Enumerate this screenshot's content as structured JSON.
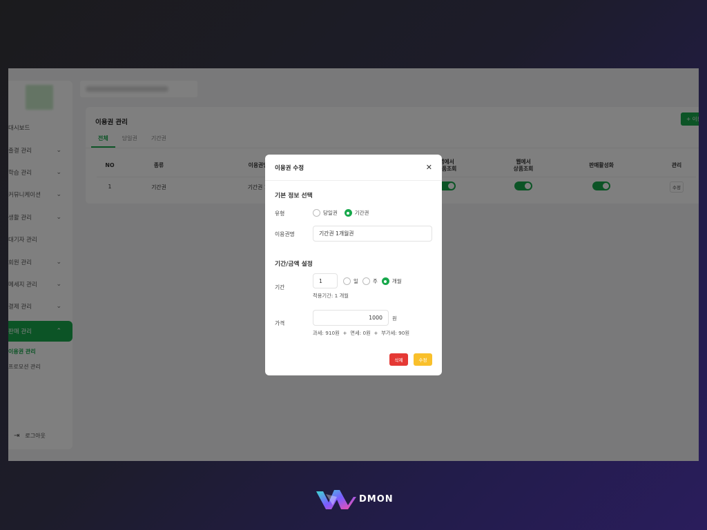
{
  "sidebar": {
    "items": [
      {
        "label": "대시보드",
        "chev": ""
      },
      {
        "label": "출결 관리",
        "chev": "⌄"
      },
      {
        "label": "학습 관리",
        "chev": "⌄"
      },
      {
        "label": "커뮤니케이션",
        "chev": "⌄"
      },
      {
        "label": "생활 관리",
        "chev": "⌄"
      },
      {
        "label": "대기자 관리",
        "chev": ""
      },
      {
        "label": "회원 관리",
        "chev": "⌄"
      },
      {
        "label": "메세지 관리",
        "chev": "⌄"
      },
      {
        "label": "결제 관리",
        "chev": "⌄"
      },
      {
        "label": "판매 관리",
        "chev": "⌃"
      }
    ],
    "subitems": [
      "이용권 관리",
      "프로모션 관리"
    ],
    "logout": "로그아웃"
  },
  "card": {
    "title": "이용권 관리",
    "add_button": "+ 이용권",
    "tabs": [
      "전체",
      "당일권",
      "기간권"
    ],
    "headers": {
      "no": "NO",
      "type": "종류",
      "name": "이용권명",
      "app": "앱에서\n상품조회",
      "web": "웹에서\n상품조회",
      "sale": "판매활성화",
      "manage": "관리"
    },
    "rows": [
      {
        "no": "1",
        "type": "기간권",
        "name": "기간권 1개월권",
        "edit": "수정"
      }
    ]
  },
  "modal": {
    "title": "이용권 수정",
    "section_basic": "기본 정보 선택",
    "type_label": "유형",
    "type_options": [
      "당일권",
      "기간권"
    ],
    "name_label": "이용권명",
    "name_value": "기간권 1개월권",
    "section_period": "기간/금액 설정",
    "period_label": "기간",
    "period_value": "1",
    "period_units": [
      "일",
      "주",
      "개월"
    ],
    "period_hint": "적용기간: 1 개월",
    "price_label": "가격",
    "price_value": "1000",
    "price_unit": "원",
    "tax_hint": "과세: 910원  +  면세: 0원  +  부가세: 90원",
    "delete_button": "삭제",
    "save_button": "수정"
  },
  "brand": {
    "name": "DMON"
  },
  "colors": {
    "accent": "#18a84c",
    "delete": "#e53935",
    "save": "#f9c02b"
  }
}
